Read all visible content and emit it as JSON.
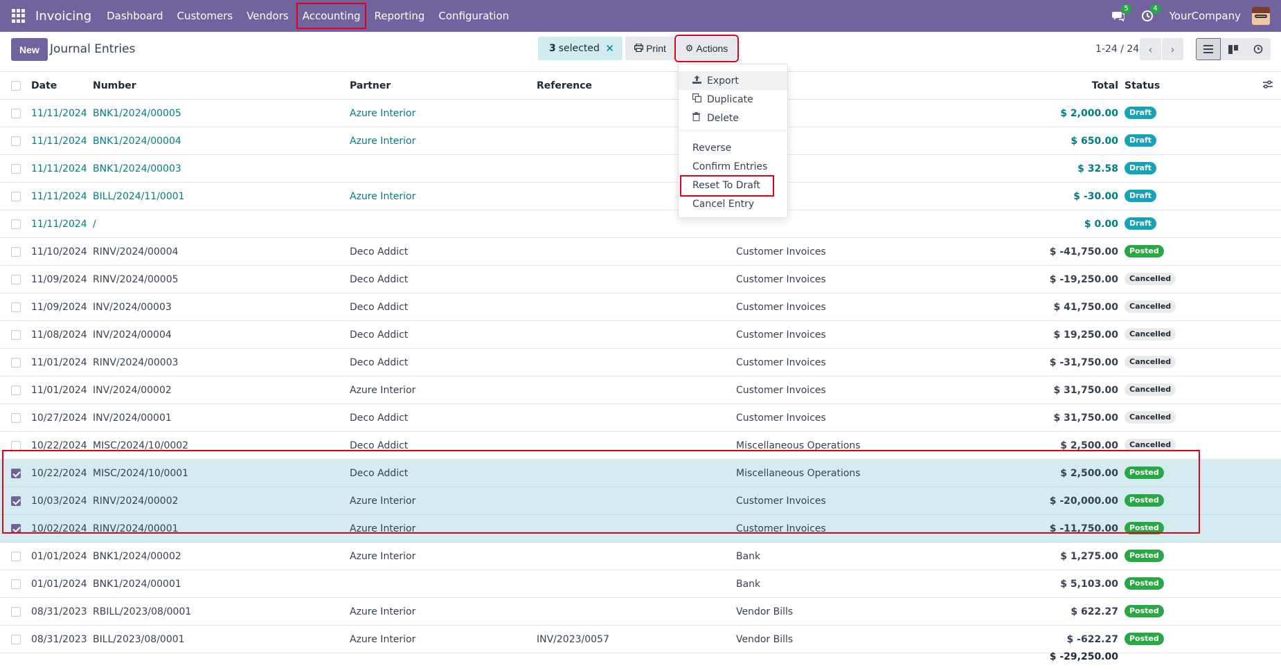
{
  "navbar": {
    "brand": "Invoicing",
    "menu": [
      "Dashboard",
      "Customers",
      "Vendors",
      "Accounting",
      "Reporting",
      "Configuration"
    ],
    "messages_count": "5",
    "activities_count": "4",
    "company": "YourCompany"
  },
  "control": {
    "new_label": "New",
    "title": "Journal Entries",
    "selected_count": "3",
    "selected_label": "selected",
    "print_label": "Print",
    "actions_label": "Actions",
    "pager": "1-24 / 24"
  },
  "table": {
    "headers": {
      "date": "Date",
      "number": "Number",
      "partner": "Partner",
      "reference": "Reference",
      "total": "Total",
      "status": "Status"
    },
    "rows": [
      {
        "date": "11/11/2024",
        "number": "BNK1/2024/00005",
        "partner": "Azure Interior",
        "reference": "",
        "journal": "",
        "total": "$ 2,000.00",
        "status": "Draft",
        "checked": false
      },
      {
        "date": "11/11/2024",
        "number": "BNK1/2024/00004",
        "partner": "Azure Interior",
        "reference": "",
        "journal": "",
        "total": "$ 650.00",
        "status": "Draft",
        "checked": false
      },
      {
        "date": "11/11/2024",
        "number": "BNK1/2024/00003",
        "partner": "",
        "reference": "",
        "journal": "",
        "total": "$ 32.58",
        "status": "Draft",
        "checked": false
      },
      {
        "date": "11/11/2024",
        "number": "BILL/2024/11/0001",
        "partner": "Azure Interior",
        "reference": "",
        "journal": "",
        "total": "$ -30.00",
        "status": "Draft",
        "checked": false
      },
      {
        "date": "11/11/2024",
        "number": "/",
        "partner": "",
        "reference": "",
        "journal": "",
        "total": "$ 0.00",
        "status": "Draft",
        "checked": false
      },
      {
        "date": "11/10/2024",
        "number": "RINV/2024/00004",
        "partner": "Deco Addict",
        "reference": "",
        "journal": "Customer Invoices",
        "total": "$ -41,750.00",
        "status": "Posted",
        "checked": false
      },
      {
        "date": "11/09/2024",
        "number": "RINV/2024/00005",
        "partner": "Deco Addict",
        "reference": "",
        "journal": "Customer Invoices",
        "total": "$ -19,250.00",
        "status": "Cancelled",
        "checked": false
      },
      {
        "date": "11/09/2024",
        "number": "INV/2024/00003",
        "partner": "Deco Addict",
        "reference": "",
        "journal": "Customer Invoices",
        "total": "$ 41,750.00",
        "status": "Cancelled",
        "checked": false
      },
      {
        "date": "11/08/2024",
        "number": "INV/2024/00004",
        "partner": "Deco Addict",
        "reference": "",
        "journal": "Customer Invoices",
        "total": "$ 19,250.00",
        "status": "Cancelled",
        "checked": false
      },
      {
        "date": "11/01/2024",
        "number": "RINV/2024/00003",
        "partner": "Deco Addict",
        "reference": "",
        "journal": "Customer Invoices",
        "total": "$ -31,750.00",
        "status": "Cancelled",
        "checked": false
      },
      {
        "date": "11/01/2024",
        "number": "INV/2024/00002",
        "partner": "Azure Interior",
        "reference": "",
        "journal": "Customer Invoices",
        "total": "$ 31,750.00",
        "status": "Cancelled",
        "checked": false
      },
      {
        "date": "10/27/2024",
        "number": "INV/2024/00001",
        "partner": "Deco Addict",
        "reference": "",
        "journal": "Customer Invoices",
        "total": "$ 31,750.00",
        "status": "Cancelled",
        "checked": false
      },
      {
        "date": "10/22/2024",
        "number": "MISC/2024/10/0002",
        "partner": "Deco Addict",
        "reference": "",
        "journal": "Miscellaneous Operations",
        "total": "$ 2,500.00",
        "status": "Cancelled",
        "checked": false
      },
      {
        "date": "10/22/2024",
        "number": "MISC/2024/10/0001",
        "partner": "Deco Addict",
        "reference": "",
        "journal": "Miscellaneous Operations",
        "total": "$ 2,500.00",
        "status": "Posted",
        "checked": true
      },
      {
        "date": "10/03/2024",
        "number": "RINV/2024/00002",
        "partner": "Azure Interior",
        "reference": "",
        "journal": "Customer Invoices",
        "total": "$ -20,000.00",
        "status": "Posted",
        "checked": true
      },
      {
        "date": "10/02/2024",
        "number": "RINV/2024/00001",
        "partner": "Azure Interior",
        "reference": "",
        "journal": "Customer Invoices",
        "total": "$ -11,750.00",
        "status": "Posted",
        "checked": true
      },
      {
        "date": "01/01/2024",
        "number": "BNK1/2024/00002",
        "partner": "Azure Interior",
        "reference": "",
        "journal": "Bank",
        "total": "$ 1,275.00",
        "status": "Posted",
        "checked": false
      },
      {
        "date": "01/01/2024",
        "number": "BNK1/2024/00001",
        "partner": "",
        "reference": "",
        "journal": "Bank",
        "total": "$ 5,103.00",
        "status": "Posted",
        "checked": false
      },
      {
        "date": "08/31/2023",
        "number": "RBILL/2023/08/0001",
        "partner": "Azure Interior",
        "reference": "",
        "journal": "Vendor Bills",
        "total": "$ 622.27",
        "status": "Posted",
        "checked": false
      },
      {
        "date": "08/31/2023",
        "number": "BILL/2023/08/0001",
        "partner": "Azure Interior",
        "reference": "INV/2023/0057",
        "journal": "Vendor Bills",
        "total": "$ -622.27",
        "status": "Posted",
        "checked": false
      }
    ],
    "grand_total": "$ -29,250.00"
  },
  "actions_menu": {
    "items": [
      "Export",
      "Duplicate",
      "Delete",
      "Reverse",
      "Confirm Entries",
      "Reset To Draft",
      "Cancel Entry"
    ]
  },
  "colors": {
    "brand": "#71639e",
    "link": "#017e84",
    "posted": "#28a745",
    "draft": "#17a2b8",
    "selected_row": "#d4ecef",
    "highlight": "#e3001b"
  }
}
